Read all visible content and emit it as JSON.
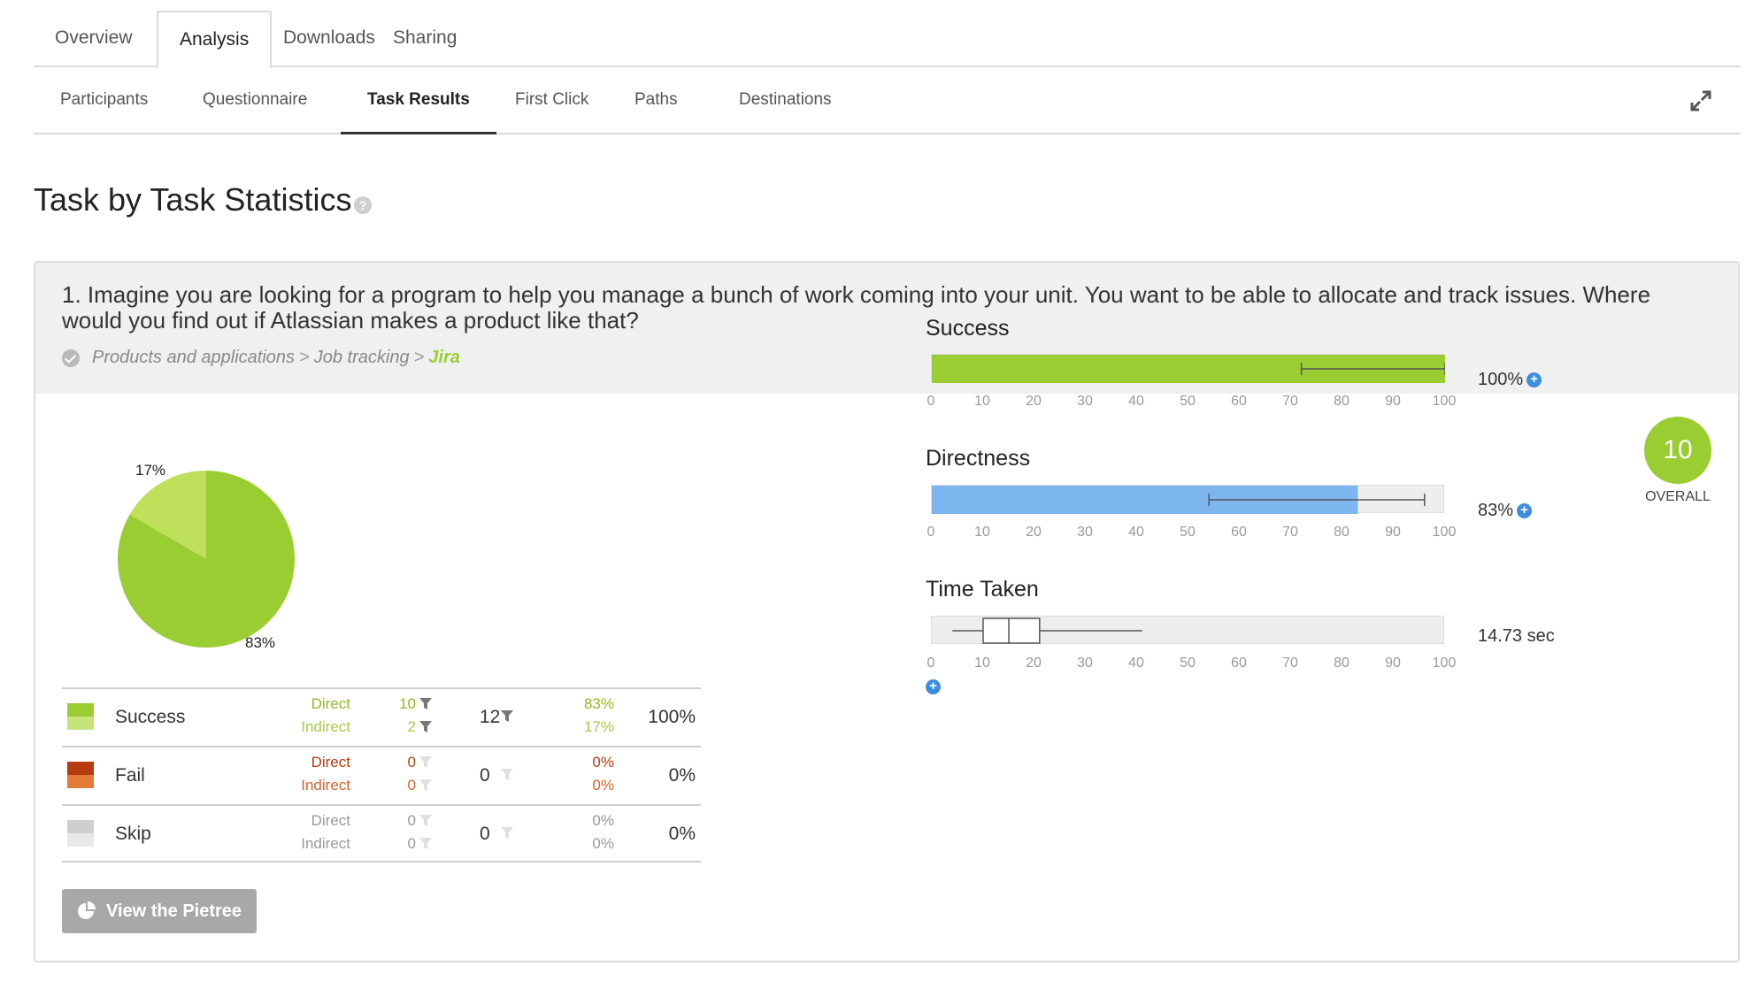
{
  "top_tabs": [
    "Overview",
    "Analysis",
    "Downloads",
    "Sharing"
  ],
  "sub_tabs": [
    "Participants",
    "Questionnaire",
    "Task Results",
    "First Click",
    "Paths",
    "Destinations"
  ],
  "section": {
    "title": "Task by Task Statistics",
    "help": "?"
  },
  "task": {
    "text": "1. Imagine you are looking for a program to help you manage a bunch of work coming into your unit. You want to be able to allocate and track issues. Where would you find out if Atlassian makes a product like that?",
    "crumbs": [
      "Products and applications",
      "Job tracking"
    ],
    "crumb_final": "Jira",
    "crumb_sep": ">"
  },
  "pie": {
    "label_small": "17%",
    "label_large": "83%",
    "colors": {
      "direct": "#9acd32",
      "indirect": "#bfe05a"
    }
  },
  "results": {
    "rows": [
      {
        "name": "Success",
        "direct_label": "Direct",
        "indirect_label": "Indirect",
        "direct": "10",
        "indirect": "2",
        "total": "12",
        "direct_pct": "83%",
        "indirect_pct": "17%",
        "pct": "100%",
        "color_top": "#9acd32",
        "color_bot": "#c5e57a",
        "label_color_direct": "#8dbb20",
        "label_color_indirect": "#a5cc45"
      },
      {
        "name": "Fail",
        "direct_label": "Direct",
        "indirect_label": "Indirect",
        "direct": "0",
        "indirect": "0",
        "total": "0",
        "direct_pct": "0%",
        "indirect_pct": "0%",
        "pct": "0%",
        "color_top": "#b83a10",
        "color_bot": "#e27a3a",
        "label_color_direct": "#b83a10",
        "label_color_indirect": "#d9612a"
      },
      {
        "name": "Skip",
        "direct_label": "Direct",
        "indirect_label": "Indirect",
        "direct": "0",
        "indirect": "0",
        "total": "0",
        "direct_pct": "0%",
        "indirect_pct": "0%",
        "pct": "0%",
        "color_top": "#cfcfcf",
        "color_bot": "#e8e8e8",
        "label_color_direct": "#999999",
        "label_color_indirect": "#999999"
      }
    ]
  },
  "pietree_button": "View the Pietree",
  "overall": {
    "score": "10",
    "label": "OVERALL"
  },
  "metrics": {
    "axis_ticks": [
      "0",
      "10",
      "20",
      "30",
      "40",
      "50",
      "60",
      "70",
      "80",
      "90",
      "100"
    ],
    "success": {
      "title": "Success",
      "value": "100%",
      "fill": 100,
      "whisker": [
        72,
        100
      ],
      "color": "#9acd32"
    },
    "directness": {
      "title": "Directness",
      "value": "83%",
      "fill": 83,
      "whisker": [
        54,
        96
      ],
      "color": "#7db6ee"
    },
    "time": {
      "title": "Time Taken",
      "value": "14.73 sec",
      "whisker": [
        4,
        41
      ],
      "box": [
        10,
        21
      ],
      "median": 15
    }
  }
}
